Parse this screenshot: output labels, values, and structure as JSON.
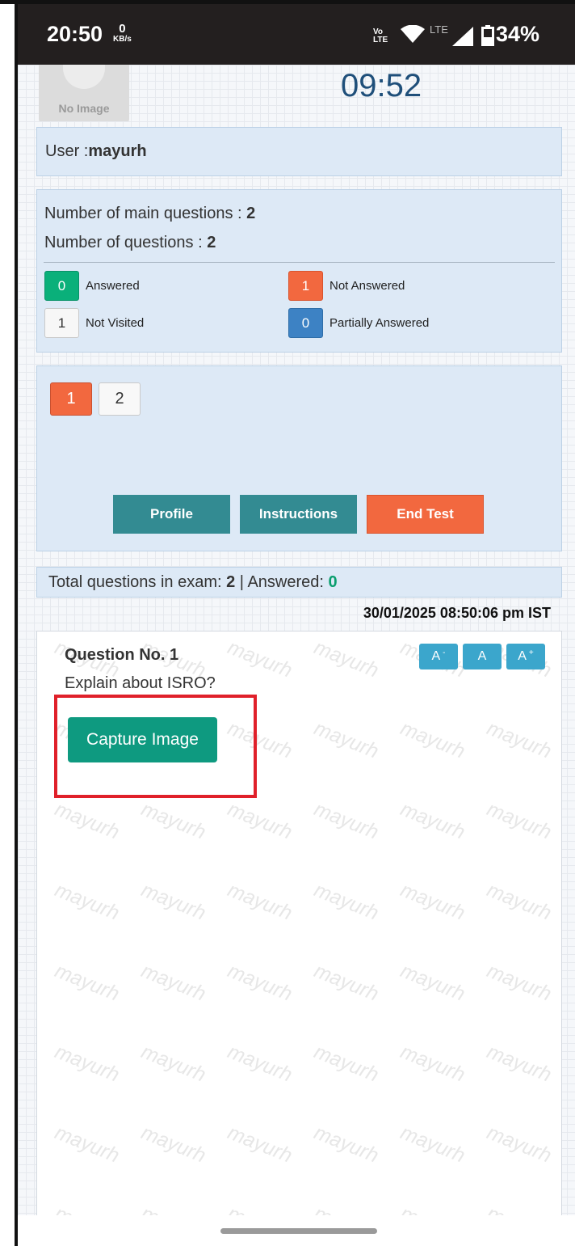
{
  "status_bar": {
    "time": "20:50",
    "net_speed_value": "0",
    "net_speed_unit": "KB/s",
    "volte": "Vo LTE",
    "lte": "LTE",
    "battery": "34%",
    "icons": [
      "wifi-icon",
      "signal-icon",
      "battery-icon"
    ]
  },
  "header": {
    "no_image_label": "No Image",
    "timer": "09:52"
  },
  "user": {
    "label": "User :",
    "name": "mayurh"
  },
  "stats": {
    "main_questions_label": "Number of main questions : ",
    "main_questions_value": "2",
    "questions_label": "Number of questions : ",
    "questions_value": "2",
    "legend": [
      {
        "count": "0",
        "label": "Answered",
        "color": "#0ab07a"
      },
      {
        "count": "1",
        "label": "Not Answered",
        "color": "#f2683f"
      },
      {
        "count": "1",
        "label": "Not Visited",
        "color": "#f7f7f7"
      },
      {
        "count": "0",
        "label": "Partially Answered",
        "color": "#3d82c4"
      }
    ]
  },
  "navigation": {
    "questions": [
      "1",
      "2"
    ],
    "current": "1",
    "profile_label": "Profile",
    "instructions_label": "Instructions",
    "end_test_label": "End Test"
  },
  "summary": {
    "total_label": "Total questions in exam: ",
    "total_value": "2",
    "separator": " | Answered: ",
    "answered_value": "0"
  },
  "datetime": "30/01/2025 08:50:06 pm IST",
  "question": {
    "title": "Question No. 1",
    "text": "Explain about ISRO?",
    "font_decrease": "A",
    "font_reset": "A",
    "font_increase": "A",
    "capture_label": "Capture Image",
    "watermark": "mayurh"
  },
  "colors": {
    "accent_teal": "#338b92",
    "accent_orange": "#f2683f",
    "capture_green": "#0e9a80",
    "highlight_red": "#e0202a",
    "timer_blue": "#1f4f7a"
  }
}
